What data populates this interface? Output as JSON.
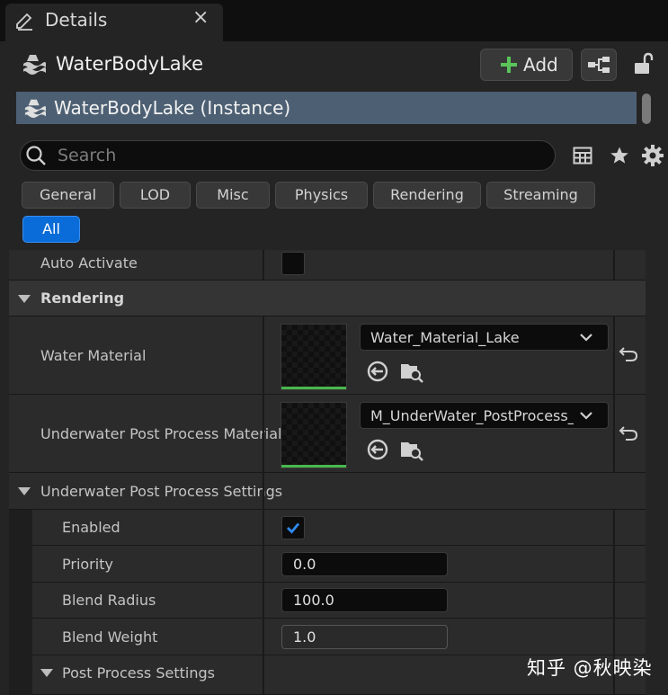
{
  "tab": {
    "title": "Details",
    "close_glyph": "×"
  },
  "header": {
    "actor_name": "WaterBodyLake",
    "add_button": {
      "label": "Add",
      "icon": "plus-icon",
      "icon_color": "#5ac45a"
    },
    "instance_label": "WaterBodyLake (Instance)"
  },
  "search": {
    "placeholder": "Search",
    "value": ""
  },
  "filters": [
    {
      "label": "General",
      "active": false
    },
    {
      "label": "LOD",
      "active": false
    },
    {
      "label": "Misc",
      "active": false
    },
    {
      "label": "Physics",
      "active": false
    },
    {
      "label": "Rendering",
      "active": false
    },
    {
      "label": "Streaming",
      "active": false
    },
    {
      "label": "All",
      "active": true
    }
  ],
  "properties": {
    "auto_activate": {
      "label": "Auto Activate",
      "checked": false
    },
    "rendering_category": "Rendering",
    "water_material": {
      "label": "Water Material",
      "value": "Water_Material_Lake"
    },
    "underwater_material": {
      "label": "Underwater Post Process Material",
      "value": "M_UnderWater_PostProcess_Volume"
    },
    "underwater_settings": {
      "label": "Underwater Post Process Settings",
      "enabled": {
        "label": "Enabled",
        "checked": true
      },
      "priority": {
        "label": "Priority",
        "value": "0.0"
      },
      "blend_radius": {
        "label": "Blend Radius",
        "value": "100.0"
      },
      "blend_weight": {
        "label": "Blend Weight",
        "value": "1.0"
      },
      "post_process_settings": {
        "label": "Post Process Settings"
      }
    }
  },
  "colors": {
    "accent_blue": "#0a6cd8",
    "selection": "#4d6073",
    "thumb_bar": "#48b84c",
    "check": "#2f8af0"
  },
  "watermark": "知乎 @秋映染"
}
